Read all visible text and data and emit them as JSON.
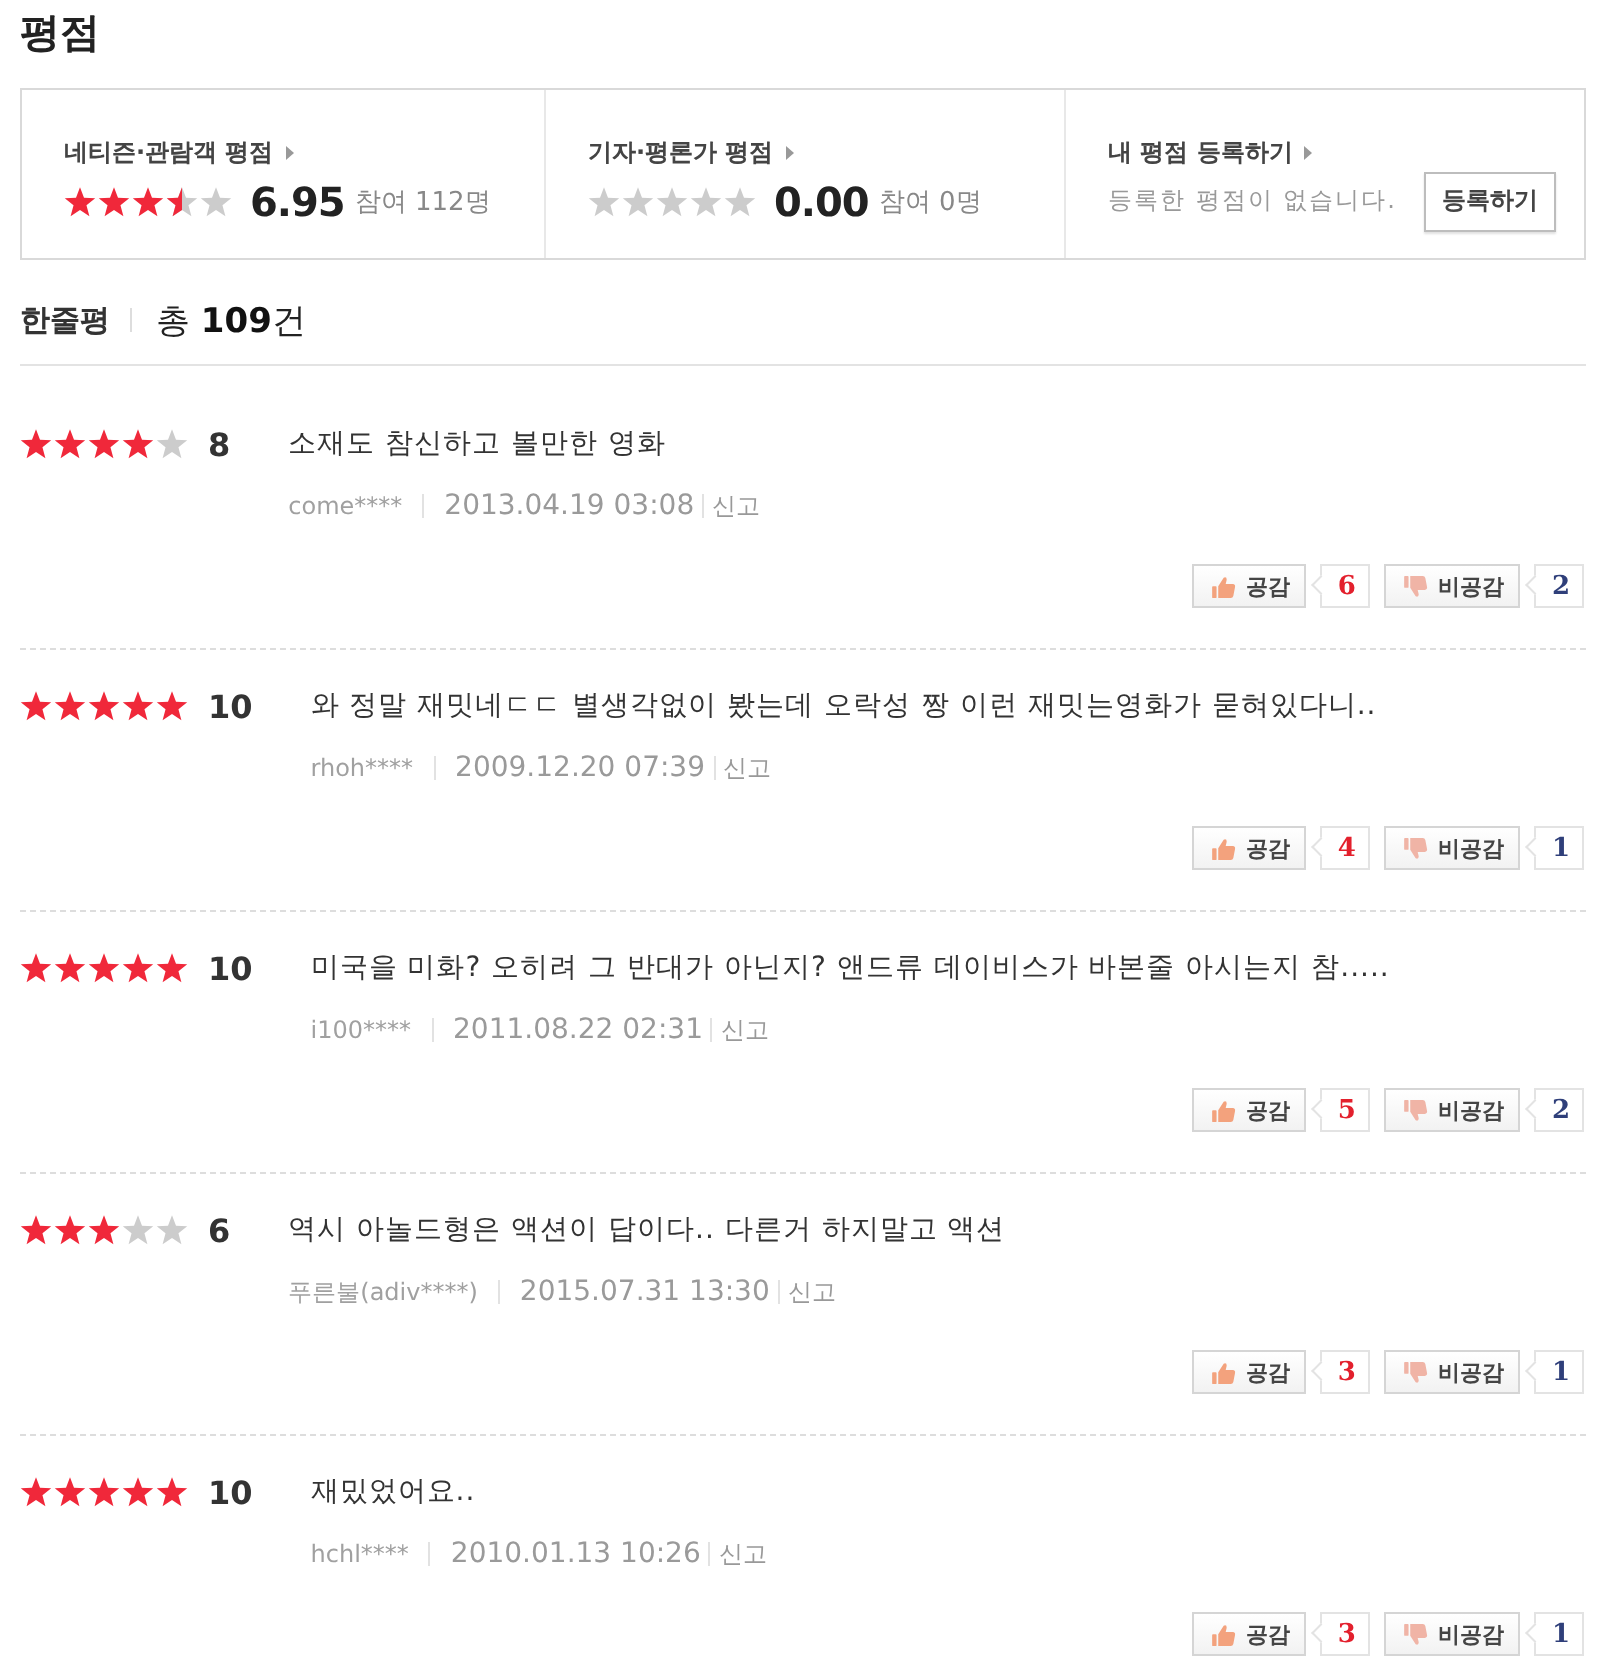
{
  "section_title": "평점",
  "summary": [
    {
      "kind": "rating",
      "label": "네티즌·관람객 평점",
      "stars": 3.5,
      "score": "6.95",
      "participants": "참여 112명"
    },
    {
      "kind": "rating",
      "label": "기자·평론가 평점",
      "stars": 0,
      "score": "0.00",
      "participants": "참여 0명"
    },
    {
      "kind": "register",
      "label": "내 평점 등록하기",
      "message": "등록한 평점이 없습니다.",
      "button": "등록하기"
    }
  ],
  "reviews_header": {
    "title": "한줄평",
    "total": "총 **109**건"
  },
  "reviews": [
    {
      "stars": 4,
      "score": "8",
      "text": "소재도 참신하고 볼만한 영화",
      "author": "come****",
      "date": "2013.04.19 03:08",
      "report": "신고",
      "like_label": "공감",
      "likes": "6",
      "dislike_label": "비공감",
      "dislikes": "2"
    },
    {
      "stars": 5,
      "score": "10",
      "text": "와 정말 재밋네ㄷㄷ 별생각없이 봤는데 오락성 짱 이런 재밋는영화가 묻혀있다니..",
      "author": "rhoh****",
      "date": "2009.12.20 07:39",
      "report": "신고",
      "like_label": "공감",
      "likes": "4",
      "dislike_label": "비공감",
      "dislikes": "1"
    },
    {
      "stars": 5,
      "score": "10",
      "text": "미국을 미화? 오히려 그 반대가 아닌지? 앤드류 데이비스가 바본줄 아시는지 참.....",
      "author": "i100****",
      "date": "2011.08.22 02:31",
      "report": "신고",
      "like_label": "공감",
      "likes": "5",
      "dislike_label": "비공감",
      "dislikes": "2"
    },
    {
      "stars": 3,
      "score": "6",
      "text": "역시 아놀드형은 액션이 답이다.. 다른거 하지말고 액션",
      "author": "푸른불(adiv****)",
      "date": "2015.07.31 13:30",
      "report": "신고",
      "like_label": "공감",
      "likes": "3",
      "dislike_label": "비공감",
      "dislikes": "1"
    },
    {
      "stars": 5,
      "score": "10",
      "text": "재밌었어요..",
      "author": "hchl****",
      "date": "2010.01.13 10:26",
      "report": "신고",
      "like_label": "공감",
      "likes": "3",
      "dislike_label": "비공감",
      "dislikes": "1"
    }
  ]
}
